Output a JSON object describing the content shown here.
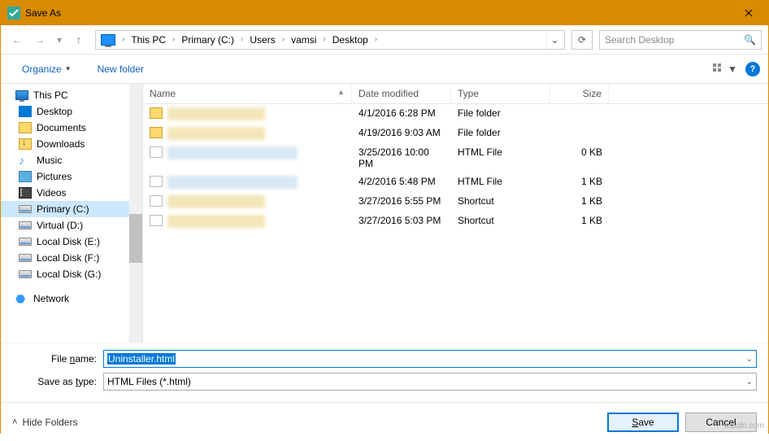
{
  "title": "Save As",
  "breadcrumbs": [
    "This PC",
    "Primary (C:)",
    "Users",
    "vamsi",
    "Desktop"
  ],
  "search_placeholder": "Search Desktop",
  "toolbar": {
    "organize": "Organize",
    "new_folder": "New folder"
  },
  "tree": {
    "root": "This PC",
    "items": [
      "Desktop",
      "Documents",
      "Downloads",
      "Music",
      "Pictures",
      "Videos",
      "Primary (C:)",
      "Virtual (D:)",
      "Local Disk (E:)",
      "Local Disk (F:)",
      "Local Disk (G:)"
    ],
    "network": "Network"
  },
  "columns": {
    "name": "Name",
    "date": "Date modified",
    "type": "Type",
    "size": "Size"
  },
  "rows": [
    {
      "date": "4/1/2016 6:28 PM",
      "type": "File folder",
      "size": ""
    },
    {
      "date": "4/19/2016 9:03 AM",
      "type": "File folder",
      "size": ""
    },
    {
      "date": "3/25/2016 10:00 PM",
      "type": "HTML File",
      "size": "0 KB"
    },
    {
      "date": "4/2/2016 5:48 PM",
      "type": "HTML File",
      "size": "1 KB"
    },
    {
      "date": "3/27/2016 5:55 PM",
      "type": "Shortcut",
      "size": "1 KB"
    },
    {
      "date": "3/27/2016 5:03 PM",
      "type": "Shortcut",
      "size": "1 KB"
    }
  ],
  "fields": {
    "name_label": "File name:",
    "name_value": "Uninstaller.html",
    "type_label": "Save as type:",
    "type_value": "HTML Files (*.html)"
  },
  "footer": {
    "hide": "Hide Folders",
    "save": "Save",
    "cancel": "Cancel"
  },
  "watermark": "wsxdn.com"
}
